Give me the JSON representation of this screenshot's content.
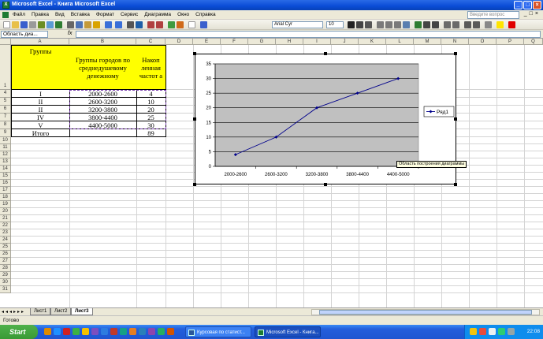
{
  "window": {
    "title": "Microsoft Excel - Книга Microsoft Excel",
    "icon": "excel-icon"
  },
  "menu": {
    "items": [
      "Файл",
      "Правка",
      "Вид",
      "Вставка",
      "Формат",
      "Сервис",
      "Диаграмма",
      "Окно",
      "Справка"
    ],
    "help_placeholder": "Введите вопрос"
  },
  "toolbar": {
    "font_name": "Arial Cyr",
    "font_size": "10"
  },
  "formula_bar": {
    "name_box": "Область диа...",
    "fx": "fx",
    "formula": ""
  },
  "columns": [
    "A",
    "B",
    "C",
    "D",
    "E",
    "F",
    "G",
    "H",
    "I",
    "J",
    "K",
    "L",
    "M",
    "N",
    "O",
    "P",
    "Q"
  ],
  "rows": [
    "1",
    "4",
    "5",
    "6",
    "7",
    "8",
    "9",
    "10",
    "11",
    "12",
    "13",
    "14",
    "15",
    "16",
    "17",
    "18",
    "19",
    "20",
    "21",
    "22",
    "23",
    "24",
    "25",
    "26",
    "27",
    "28",
    "29",
    "30",
    "31"
  ],
  "table": {
    "headers": [
      "Группы",
      "Группы городов по среднедушевому денежному",
      "Накоп ленная частот а"
    ],
    "rows": [
      [
        "I",
        "2000-2600",
        "4"
      ],
      [
        "II",
        "2600-3200",
        "10"
      ],
      [
        "II",
        "3200-3800",
        "20"
      ],
      [
        "IV",
        "3800-4400",
        "25"
      ],
      [
        "V",
        "4400-5000",
        "30"
      ]
    ],
    "total_label": "Итого",
    "total_value": "89"
  },
  "chart_data": {
    "type": "line",
    "categories": [
      "2000-2600",
      "2600-3200",
      "3200-3800",
      "3800-4400",
      "4400-5000"
    ],
    "series": [
      {
        "name": "Ряд1",
        "values": [
          4,
          10,
          20,
          25,
          30
        ],
        "color": "#00008B"
      }
    ],
    "ylim": [
      0,
      35
    ],
    "yticks": [
      0,
      5,
      10,
      15,
      20,
      25,
      30,
      35
    ],
    "plot_bg": "#C0C0C0",
    "grid": true,
    "legend_position": "right"
  },
  "tooltip": "Область построения диаграммы",
  "sheets": {
    "tabs": [
      "Лист1",
      "Лист2",
      "Лист3"
    ],
    "active": "Лист3"
  },
  "status": {
    "text": "Готово"
  },
  "taskbar": {
    "start_label": "Start",
    "tasks": [
      "Курсовая по статист...",
      "Microsoft Excel - Книга..."
    ],
    "clock": "22:08"
  }
}
